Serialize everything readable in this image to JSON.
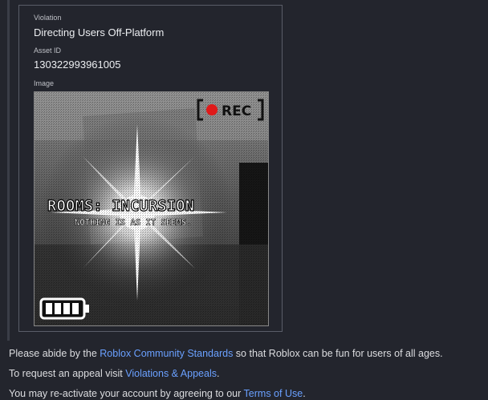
{
  "card": {
    "violation_label": "Violation",
    "violation_value": "Directing Users Off-Platform",
    "asset_label": "Asset ID",
    "asset_value": "130322993961005",
    "image_label": "Image",
    "image": {
      "rec_text": "REC",
      "title": "ROOMS: INCURSION",
      "subtitle": "NOTHING IS AS IT SEEMS.",
      "battery_bars": 4
    }
  },
  "messages": {
    "line1_prefix": "Please abide by the ",
    "line1_link": "Roblox Community Standards",
    "line1_suffix": " so that Roblox can be fun for users of all ages.",
    "line2_prefix": "To request an appeal visit ",
    "line2_link": "Violations & Appeals",
    "line2_suffix": ".",
    "line3_prefix": "You may re-activate your account by agreeing to our ",
    "line3_link": "Terms of Use",
    "line3_suffix": "."
  },
  "colors": {
    "background": "#23252d",
    "link": "#6aa0ff",
    "rec_dot": "#e01a1a"
  }
}
